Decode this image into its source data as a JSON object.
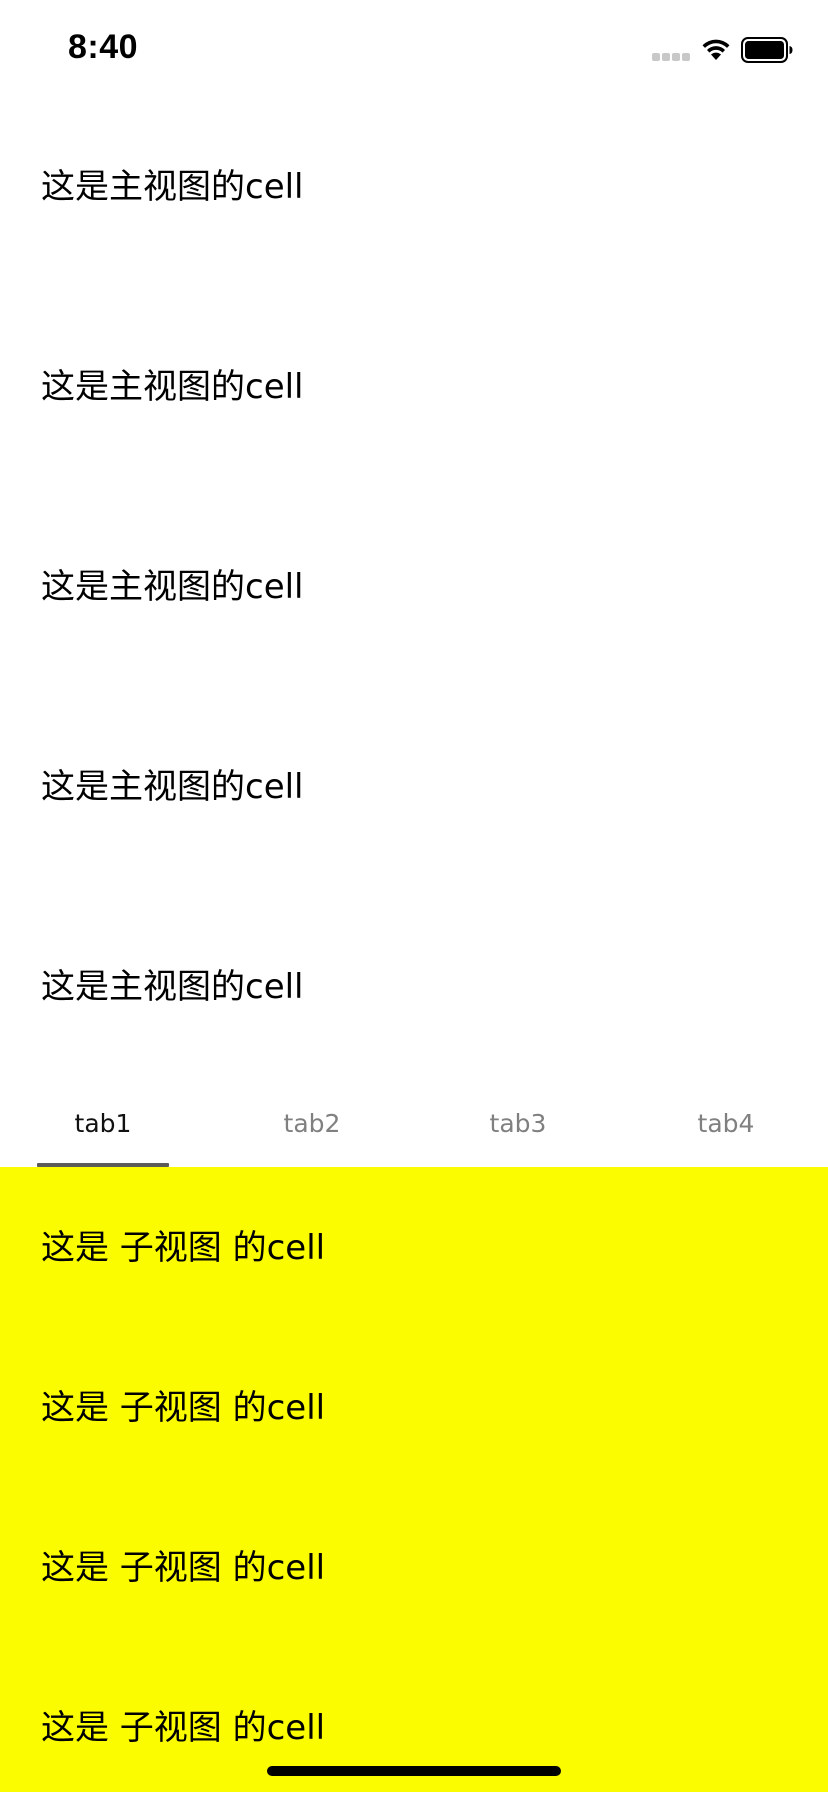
{
  "status_bar": {
    "time": "8:40"
  },
  "main_list": {
    "cells": [
      {
        "label": "这是主视图的cell"
      },
      {
        "label": "这是主视图的cell"
      },
      {
        "label": "这是主视图的cell"
      },
      {
        "label": "这是主视图的cell"
      },
      {
        "label": "这是主视图的cell"
      }
    ]
  },
  "tabs": {
    "items": [
      {
        "label": "tab1",
        "selected": true
      },
      {
        "label": "tab2",
        "selected": false
      },
      {
        "label": "tab3",
        "selected": false
      },
      {
        "label": "tab4",
        "selected": false
      }
    ]
  },
  "sub_list": {
    "background_color": "#fcfc00",
    "cells": [
      {
        "label": "这是 子视图 的cell"
      },
      {
        "label": "这是 子视图 的cell"
      },
      {
        "label": "这是 子视图 的cell"
      },
      {
        "label": "这是 子视图 的cell"
      }
    ]
  },
  "icons": {
    "signal": "cellular-signal-icon",
    "wifi": "wifi-icon",
    "battery": "battery-icon"
  }
}
